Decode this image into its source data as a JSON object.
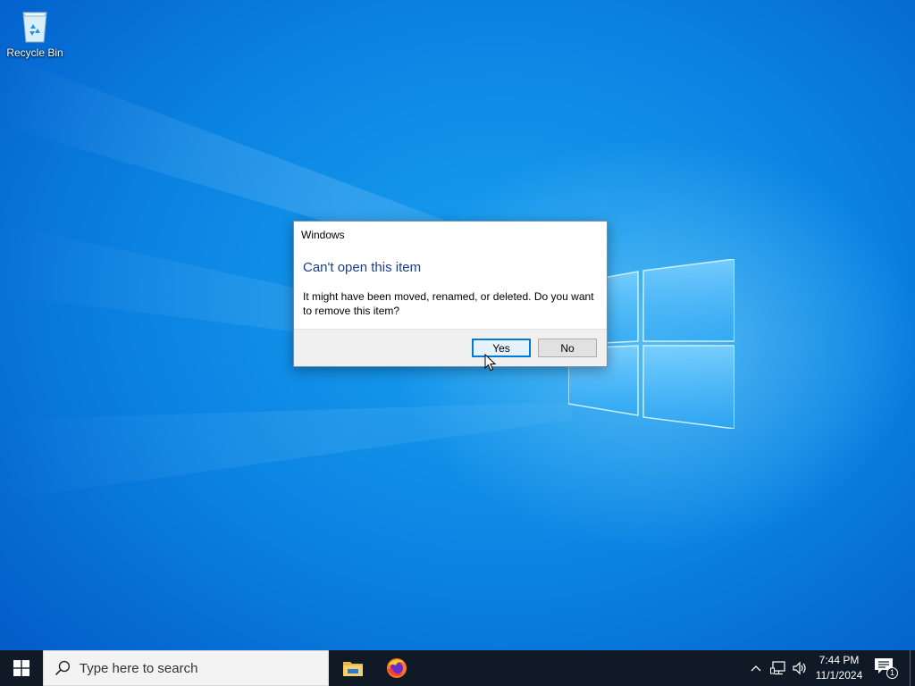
{
  "desktop": {
    "icons": [
      {
        "label": "Recycle Bin",
        "icon": "recycle-bin-icon"
      }
    ]
  },
  "dialog": {
    "title": "Windows",
    "heading": "Can't open this item",
    "message": "It might have been moved, renamed, or deleted. Do you want to remove this item?",
    "buttons": {
      "yes": "Yes",
      "no": "No"
    },
    "default_button": "yes"
  },
  "taskbar": {
    "start_icon": "windows-start-icon",
    "search_placeholder": "Type here to search",
    "pinned_apps": [
      {
        "name": "File Explorer",
        "icon": "file-explorer-icon"
      },
      {
        "name": "Firefox",
        "icon": "firefox-icon"
      }
    ],
    "tray": {
      "icons": [
        "chevron-up-icon",
        "network-icon",
        "volume-icon"
      ],
      "time": "7:44 PM",
      "date": "11/1/2024",
      "notification_count": "1"
    }
  },
  "colors": {
    "accent": "#0078d7",
    "heading": "#1c3e8f",
    "taskbar": "#101a26",
    "desktop": "#0a83e2"
  }
}
